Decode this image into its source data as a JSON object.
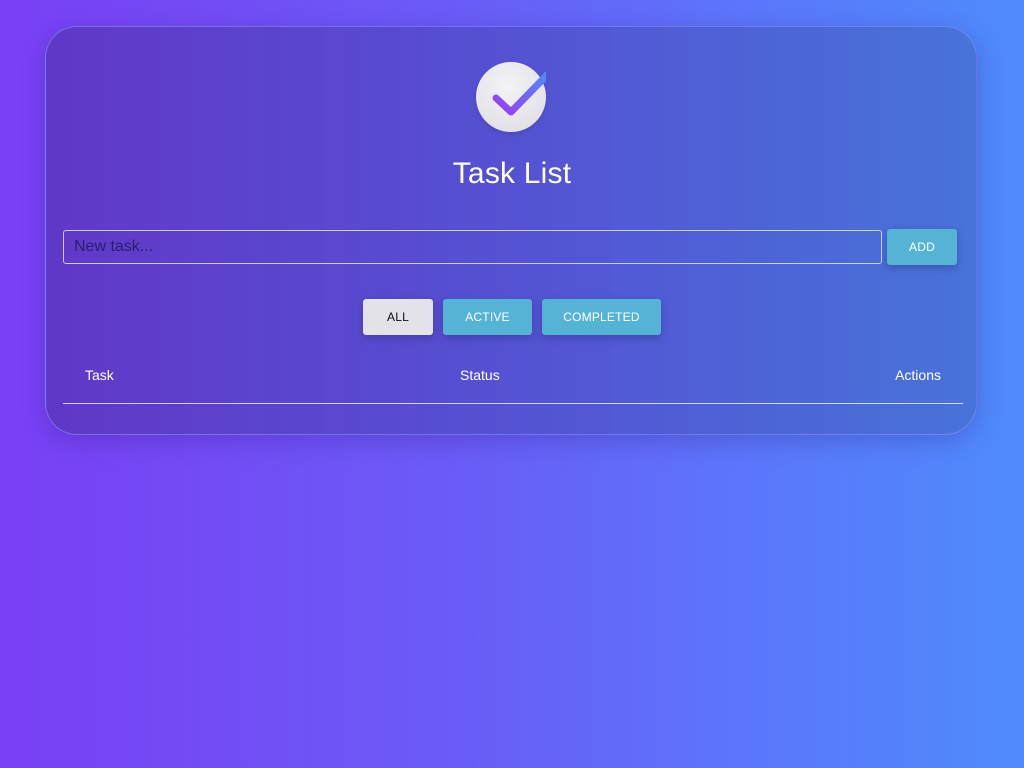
{
  "app": {
    "title": "Task List",
    "logo_icon": "check-circle-icon"
  },
  "new_task": {
    "placeholder": "New task...",
    "value": "",
    "add_label": "ADD"
  },
  "filters": {
    "all_label": "ALL",
    "active_label": "ACTIVE",
    "completed_label": "COMPLETED",
    "selected": "ALL"
  },
  "table": {
    "columns": [
      "Task",
      "Status",
      "Actions"
    ],
    "rows": []
  },
  "colors": {
    "accent": "#55b4d6",
    "selected_filter": "#e2e2e8",
    "check_gradient_start": "#9b3df0",
    "check_gradient_end": "#4f8bfd"
  }
}
